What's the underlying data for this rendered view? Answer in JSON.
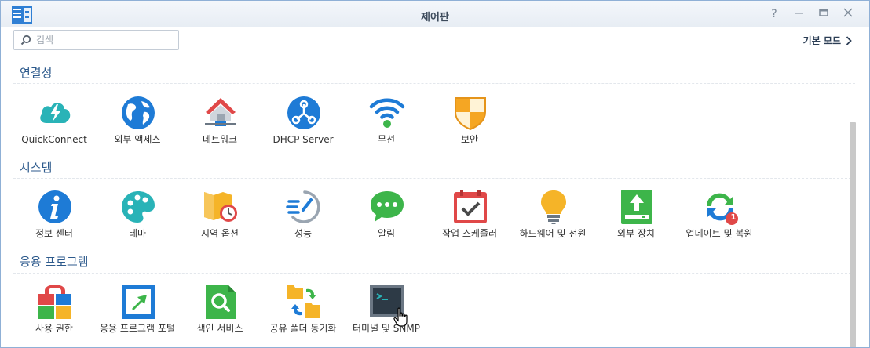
{
  "window": {
    "title": "제어판"
  },
  "search": {
    "placeholder": "검색"
  },
  "mode_link": {
    "label": "기본 모드"
  },
  "sections": [
    {
      "title": "연결성",
      "items": [
        {
          "label": "QuickConnect",
          "icon": "quickconnect-icon"
        },
        {
          "label": "외부 액세스",
          "icon": "globe-icon"
        },
        {
          "label": "네트워크",
          "icon": "network-house-icon"
        },
        {
          "label": "DHCP Server",
          "icon": "dhcp-server-icon"
        },
        {
          "label": "무선",
          "icon": "wifi-icon"
        },
        {
          "label": "보안",
          "icon": "shield-icon"
        }
      ]
    },
    {
      "title": "시스템",
      "items": [
        {
          "label": "정보 센터",
          "icon": "info-icon"
        },
        {
          "label": "테마",
          "icon": "palette-icon"
        },
        {
          "label": "지역 옵션",
          "icon": "map-clock-icon"
        },
        {
          "label": "성능",
          "icon": "gauge-icon"
        },
        {
          "label": "알림",
          "icon": "chat-bubble-icon"
        },
        {
          "label": "작업 스케줄러",
          "icon": "calendar-check-icon"
        },
        {
          "label": "하드웨어 및 전원",
          "icon": "lightbulb-icon"
        },
        {
          "label": "외부 장치",
          "icon": "external-drive-icon"
        },
        {
          "label": "업데이트 및 복원",
          "icon": "update-restore-icon",
          "badge": "1"
        }
      ]
    },
    {
      "title": "응용 프로그램",
      "items": [
        {
          "label": "사용 권한",
          "icon": "lock-grid-icon"
        },
        {
          "label": "응용 프로그램 포털",
          "icon": "portal-arrow-icon"
        },
        {
          "label": "색인 서비스",
          "icon": "search-index-icon"
        },
        {
          "label": "공유 폴더 동기화",
          "icon": "folder-sync-icon"
        },
        {
          "label": "터미널 및 SNMP",
          "icon": "terminal-icon"
        }
      ]
    }
  ],
  "colors": {
    "section_title": "#2d5a8c",
    "accent_blue": "#1e7bd6"
  }
}
